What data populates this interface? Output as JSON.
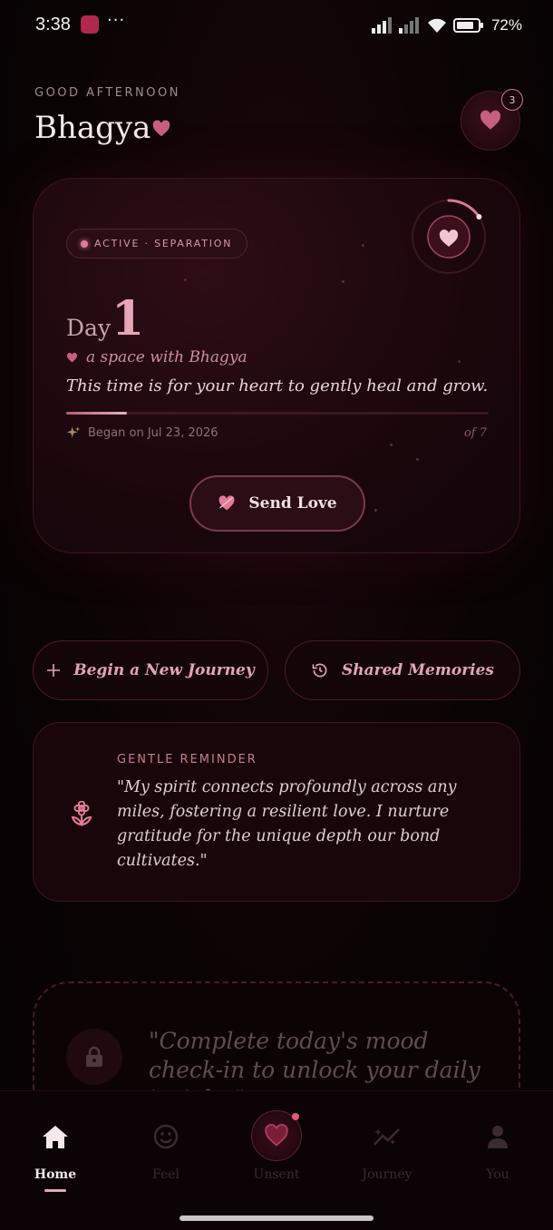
{
  "status_bar": {
    "time": "3:38",
    "overflow": "···",
    "battery": "72%"
  },
  "header": {
    "greeting": "GOOD AFTERNOON",
    "name": "Bhagya",
    "notification_count": "3"
  },
  "journey_card": {
    "status": "ACTIVE · SEPARATION",
    "day_label": "Day",
    "day_number": "1",
    "space_text": "a space with Bhagya",
    "message": "This time is for your heart to gently heal and grow.",
    "progress": 0.143,
    "began": "Began on Jul 23, 2026",
    "total": "of 7",
    "send_button": "Send Love"
  },
  "actions": {
    "new_journey": "Begin a New Journey",
    "memories": "Shared Memories"
  },
  "reminder": {
    "title": "GENTLE REMINDER",
    "text": "\"My spirit connects profoundly across any miles, fostering a resilient love. I nurture gratitude for the unique depth our bond cultivates.\""
  },
  "locked": {
    "text": "\"Complete today's mood check-in to unlock your daily insight.\""
  },
  "nav": {
    "items": [
      {
        "label": "Home",
        "icon": "home-icon",
        "active": true
      },
      {
        "label": "Feel",
        "icon": "smiley-icon",
        "active": false
      },
      {
        "label": "Unsent",
        "icon": "heart-icon",
        "active": false
      },
      {
        "label": "Journey",
        "icon": "trend-icon",
        "active": false
      },
      {
        "label": "You",
        "icon": "person-icon",
        "active": false
      }
    ]
  },
  "colors": {
    "accent": "#e6a6b6",
    "heart": "#c7607f",
    "background": "#070203"
  }
}
